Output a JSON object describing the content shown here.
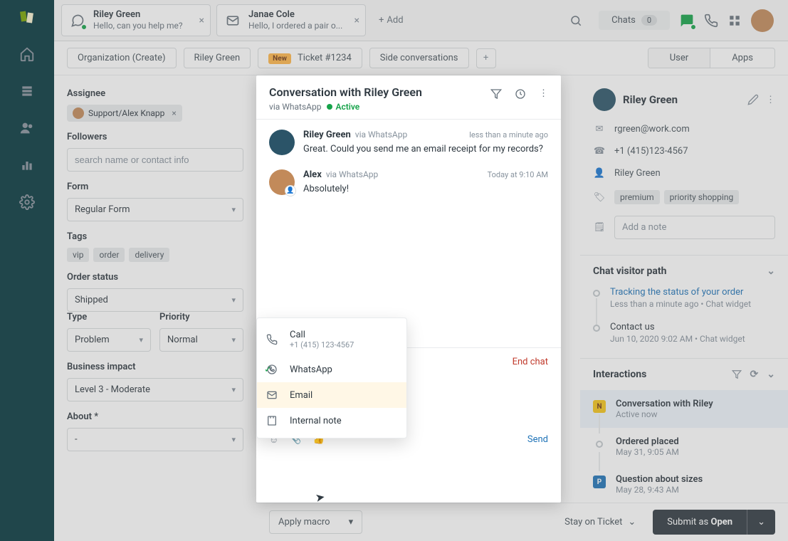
{
  "topbar": {
    "tabs": [
      {
        "title": "Riley Green",
        "subtitle": "Hello, can you help me?"
      },
      {
        "title": "Janae Cole",
        "subtitle": "Hello, I ordered a pair o..."
      }
    ],
    "add_label": "Add",
    "chats_label": "Chats",
    "chats_count": "0"
  },
  "subtabs": {
    "items": [
      "Organization (Create)",
      "Riley Green"
    ],
    "new_badge": "New",
    "ticket_label": "Ticket #1234",
    "side_conv": "Side conversations",
    "seg_user": "User",
    "seg_apps": "Apps"
  },
  "leftpanel": {
    "assignee_label": "Assignee",
    "assignee_value": "Support/Alex Knapp",
    "followers_label": "Followers",
    "followers_placeholder": "search name or contact info",
    "form_label": "Form",
    "form_value": "Regular Form",
    "tags_label": "Tags",
    "tags": [
      "vip",
      "order",
      "delivery"
    ],
    "order_status_label": "Order status",
    "order_status_value": "Shipped",
    "type_label": "Type",
    "type_value": "Problem",
    "priority_label": "Priority",
    "priority_value": "Normal",
    "impact_label": "Business impact",
    "impact_value": "Level 3 - Moderate",
    "about_label": "About *",
    "about_value": "-"
  },
  "conversation": {
    "title": "Conversation with Riley Green",
    "via": "via WhatsApp",
    "status": "Active",
    "messages": [
      {
        "name": "Riley Green",
        "via": "via WhatsApp",
        "time": "less than a minute ago",
        "body": "Great. Could you send me an email receipt for my records?"
      },
      {
        "name": "Alex",
        "via": "via WhatsApp",
        "time": "Today at 9:10 AM",
        "body": "Absolutely!"
      }
    ],
    "channel_menu": {
      "call_label": "Call",
      "call_sub": "+1 (415) 123-4567",
      "whatsapp": "WhatsApp",
      "email": "Email",
      "note": "Internal note"
    },
    "composer_channel": "WhatsApp",
    "end_chat": "End chat",
    "send": "Send"
  },
  "rightpanel": {
    "name": "Riley Green",
    "email": "rgreen@work.com",
    "phone": "+1 (415)123-4567",
    "profile": "Riley Green",
    "tags": [
      "premium",
      "priority shopping"
    ],
    "note_placeholder": "Add a note",
    "visitor_path_title": "Chat visitor path",
    "path": [
      {
        "title": "Tracking the status of your order",
        "meta": "Less than a minute ago • Chat widget",
        "link": true
      },
      {
        "title": "Contact us",
        "meta": "Jun 10, 2020 9:02 AM • Chat widget",
        "link": false
      }
    ],
    "interactions_title": "Interactions",
    "interactions": [
      {
        "badge": "N",
        "title": "Conversation with Riley",
        "meta": "Active now",
        "selected": true
      },
      {
        "badge": "o",
        "title": "Ordered placed",
        "meta": "May 31, 9:05 AM"
      },
      {
        "badge": "P",
        "title": "Question about sizes",
        "meta": "May 28, 9:43 AM"
      }
    ]
  },
  "bottombar": {
    "macro": "Apply macro",
    "stay": "Stay on Ticket",
    "submit_prefix": "Submit as ",
    "submit_status": "Open"
  }
}
